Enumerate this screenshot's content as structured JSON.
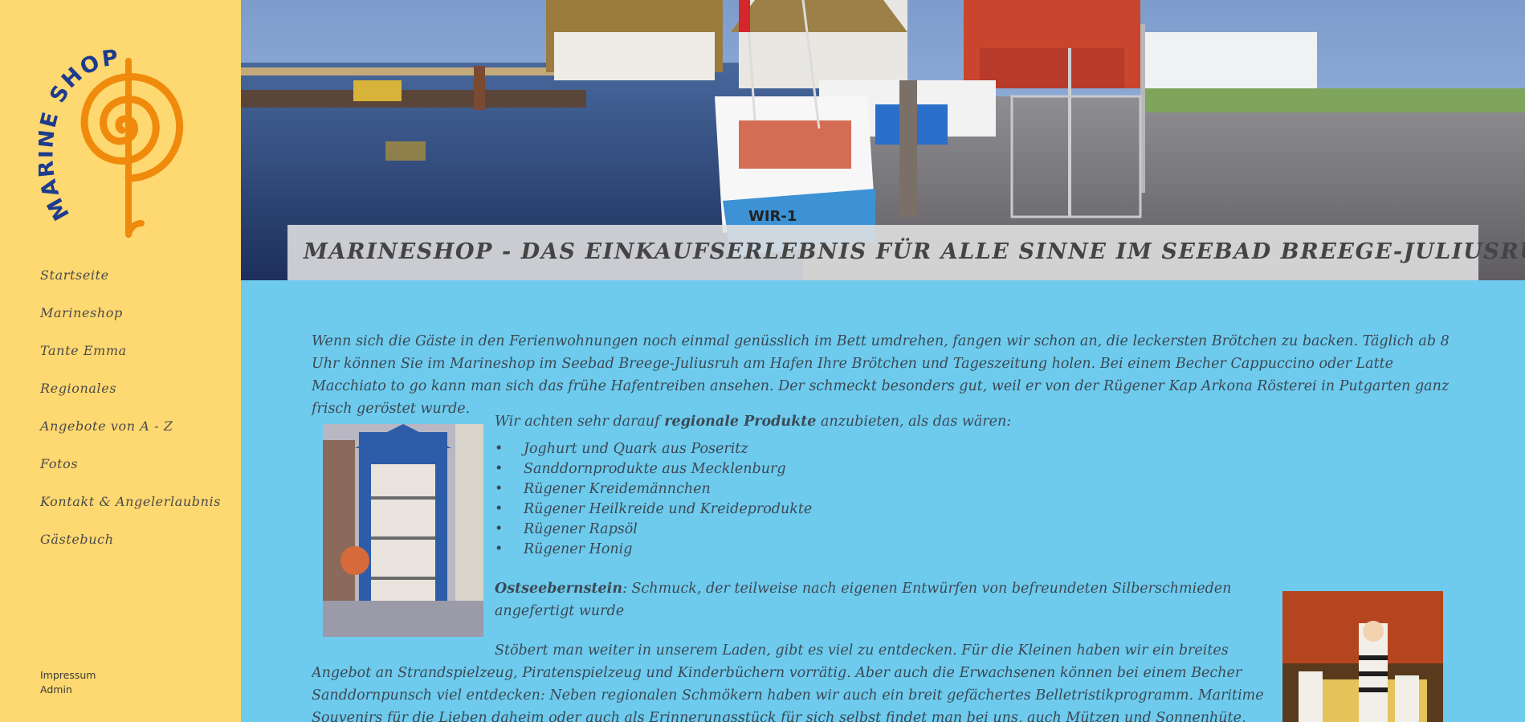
{
  "brand": {
    "logo_text": "MARINE SHOP",
    "logo_colors": {
      "text": "#1d3b8f",
      "spiral": "#f08a0c"
    }
  },
  "nav": {
    "items": [
      "Startseite",
      "Marineshop",
      "Tante Emma",
      "Regionales",
      "Angebote von A - Z",
      "Fotos",
      "Kontakt & Angelerlaubnis",
      "Gästebuch"
    ]
  },
  "footer": {
    "impressum": "Impressum",
    "admin": "Admin"
  },
  "hero": {
    "title": "MARINESHOP - DAS EINKAUFSERLEBNIS FÜR ALLE SINNE IM SEEBAD BREEGE-JULIUSRUH",
    "boat_label": "WIR-1"
  },
  "content": {
    "intro": "Wenn sich die Gäste in den Ferienwohnungen noch einmal genüsslich im Bett umdrehen, fangen wir schon an, die leckersten Brötchen zu backen. Täglich ab 8 Uhr können Sie im Marineshop im Seebad Breege-Juliusruh am Hafen Ihre Brötchen und Tageszeitung holen. Bei einem Becher Cappuccino oder Latte Macchiato to go kann man sich das frühe Hafentreiben ansehen. Der schmeckt besonders gut, weil er von der Rügener Kap Arkona Rösterei in Putgarten ganz frisch geröstet wurde.",
    "regional_pre": "Wir achten sehr darauf ",
    "regional_bold": "regionale Produkte",
    "regional_post": " anzubieten, als das wären:",
    "products": [
      "Joghurt und Quark aus Poseritz",
      "Sanddornprodukte aus Mecklenburg",
      "Rügener Kreidemännchen",
      "Rügener Heilkreide und Kreideprodukte",
      "Rügener Rapsöl",
      "Rügener Honig"
    ],
    "amber_bold": "Ostseebernstein",
    "amber_text": ": Schmuck, der teilweise nach eigenen Entwürfen von befreundeten Silberschmieden angefertigt wurde",
    "shopping": "Stöbert man weiter in unserem Laden, gibt es viel zu entdecken. Für die Kleinen haben wir ein breites Angebot an Strandspielzeug, Piratenspielzeug und Kinderbüchern vorrätig. Aber auch die Erwachsenen können bei einem Becher Sanddornpunsch viel entdecken: Neben regionalen Schmökern haben wir auch ein breit gefächertes Belletristikprogramm. Maritime Souvenirs für die Lieben daheim oder auch als Erinnerungsstück für sich selbst findet man bei uns, auch Mützen und Sonnenhüte, Angelscheine und Angelzubehör."
  },
  "colors": {
    "sidebar_bg": "#fed870",
    "content_bg": "#6ecbee",
    "text": "#3b4954"
  }
}
